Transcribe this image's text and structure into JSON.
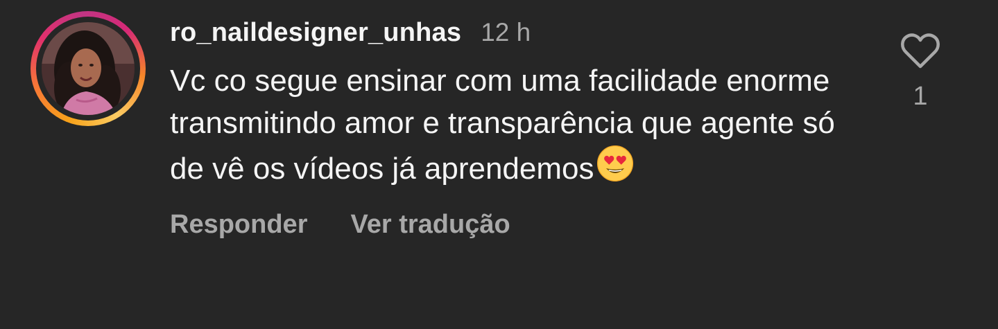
{
  "comment": {
    "username": "ro_naildesigner_unhas",
    "time": "12 h",
    "text": "Vc co segue ensinar com uma facilidade enorme transmitindo amor e transparência que agente só de vê os vídeos já aprendemos",
    "emoji": "heart-eyes-emoji",
    "like_count": "1",
    "reply_label": "Responder",
    "translate_label": "Ver tradução"
  },
  "colors": {
    "background": "#262626",
    "text_primary": "#f5f5f5",
    "text_secondary": "#a8a8a8"
  }
}
